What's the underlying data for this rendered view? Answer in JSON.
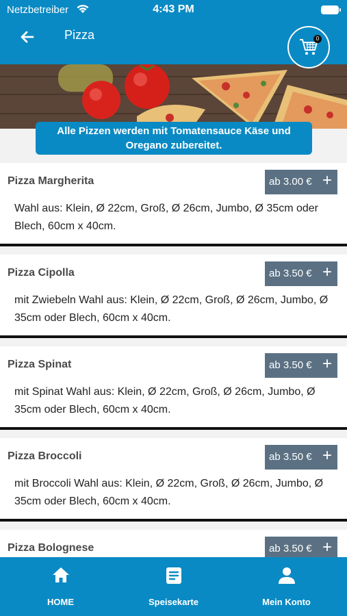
{
  "status_bar": {
    "carrier": "Netzbetreiber",
    "time": "4:43 PM"
  },
  "header": {
    "title": "Pizza",
    "back_icon": "arrow-left-icon",
    "cart_icon": "shopping-cart-icon",
    "cart_count": "0"
  },
  "hero": {
    "notice": "Alle Pizzen werden mit Tomatensauce Käse und Oregano zubereitet."
  },
  "products": [
    {
      "name": "Pizza Margherita",
      "price": "ab 3.00 €",
      "description": "Wahl aus: Klein, Ø 22cm, Groß, Ø 26cm, Jumbo, Ø 35cm oder Blech, 60cm x 40cm."
    },
    {
      "name": "Pizza Cipolla",
      "price": "ab 3.50 €",
      "description": "mit Zwiebeln Wahl aus: Klein, Ø 22cm, Groß, Ø 26cm, Jumbo, Ø 35cm oder Blech, 60cm x 40cm."
    },
    {
      "name": "Pizza Spinat",
      "price": "ab 3.50 €",
      "description": "mit Spinat Wahl aus: Klein, Ø 22cm, Groß, Ø 26cm, Jumbo, Ø 35cm oder Blech, 60cm x 40cm."
    },
    {
      "name": "Pizza Broccoli",
      "price": "ab 3.50 €",
      "description": "mit Broccoli Wahl aus: Klein, Ø 22cm, Groß, Ø 26cm, Jumbo, Ø 35cm oder Blech, 60cm x 40cm."
    },
    {
      "name": "Pizza Bolognese",
      "price": "ab 3.50 €",
      "description": ""
    }
  ],
  "bottom_nav": [
    {
      "label": "HOME",
      "icon": "home-icon"
    },
    {
      "label": "Speisekarte",
      "icon": "menu-card-icon"
    },
    {
      "label": "Mein Konto",
      "icon": "user-icon"
    }
  ],
  "colors": {
    "primary": "#0a8ac4",
    "price_button": "#5b7183",
    "background": "#f2f2f2"
  }
}
